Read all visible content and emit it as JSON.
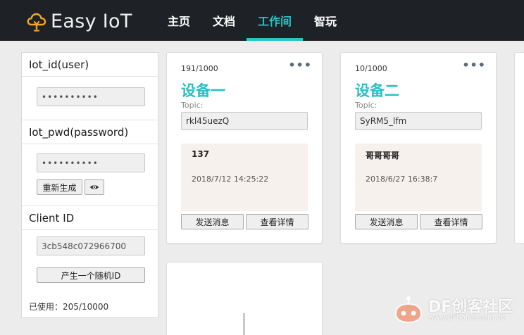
{
  "app": {
    "logo_text": "Easy IoT",
    "logo_icon": "cloud-lightbulb-icon",
    "accent_color": "#27c4c9"
  },
  "nav": {
    "items": [
      {
        "label": "主页",
        "active": false
      },
      {
        "label": "文档",
        "active": false
      },
      {
        "label": "工作间",
        "active": true
      },
      {
        "label": "智玩",
        "active": false
      }
    ]
  },
  "credentials": {
    "iot_id_label": "Iot_id(user)",
    "iot_id_value": "••••••••••",
    "iot_pwd_label": "Iot_pwd(password)",
    "iot_pwd_value": "••••••••••",
    "regenerate_label": "重新生成",
    "show_icon": "eye-icon",
    "client_id_label": "Client ID",
    "client_id_value": "3cb548c072966700",
    "random_id_label": "产生一个随机ID",
    "usage_text": "已使用：205/10000"
  },
  "devices": [
    {
      "count": "191/1000",
      "title": "设备一",
      "topic_label": "Topic:",
      "topic": "rkl45uezQ",
      "message": "137",
      "time": "2018/7/12 14:25:22",
      "send_label": "发送消息",
      "detail_label": "查看详情"
    },
    {
      "count": "10/1000",
      "title": "设备二",
      "topic_label": "Topic:",
      "topic": "SyRM5_lfm",
      "message": "哥哥哥哥",
      "time": "2018/6/27 16:38:7",
      "send_label": "发送消息",
      "detail_label": "查看详情"
    }
  ],
  "watermark": {
    "main": "DF创客社区",
    "sub": "www.DFRobot.com.cn"
  }
}
